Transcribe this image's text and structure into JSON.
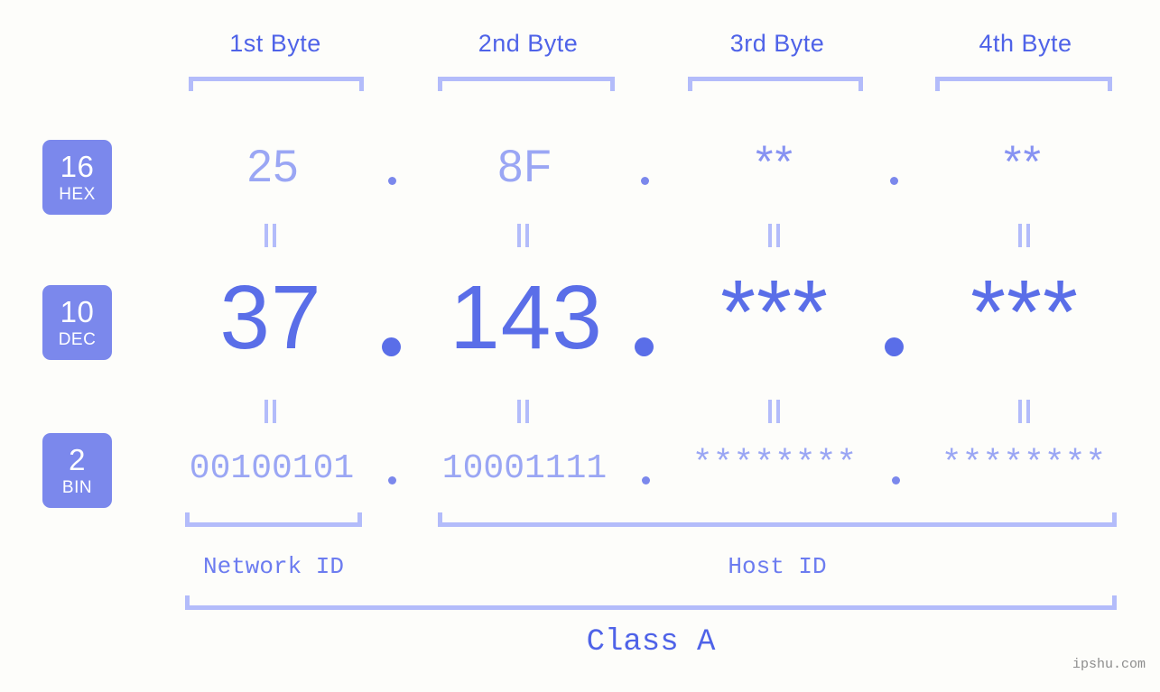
{
  "background_color": "#fdfdfa",
  "accent_colors": {
    "strong_blue": "#5a6ee8",
    "mid_blue": "#7b88ec",
    "light_blue": "#9aa6f4",
    "bracket_blue": "#b3bcfa",
    "badge_fill": "#7b88ec",
    "watermark_gray": "#8d8d8d"
  },
  "headers": {
    "byte1": "1st Byte",
    "byte2": "2nd Byte",
    "byte3": "3rd Byte",
    "byte4": "4th Byte"
  },
  "radix_rows": [
    {
      "badge_number": "16",
      "badge_name": "HEX",
      "values": [
        "25",
        "8F",
        "**",
        "**"
      ],
      "separators": [
        ".",
        ".",
        "."
      ]
    },
    {
      "badge_number": "10",
      "badge_name": "DEC",
      "values": [
        "37",
        "143",
        "***",
        "***"
      ],
      "separators": [
        ".",
        ".",
        "."
      ]
    },
    {
      "badge_number": "2",
      "badge_name": "BIN",
      "values": [
        "00100101",
        "10001111",
        "********",
        "********"
      ],
      "separators": [
        ".",
        ".",
        "."
      ]
    }
  ],
  "equality_symbol": "=",
  "sections": {
    "network_id": "Network ID",
    "host_id": "Host ID",
    "class": "Class A"
  },
  "watermark": "ipshu.com"
}
